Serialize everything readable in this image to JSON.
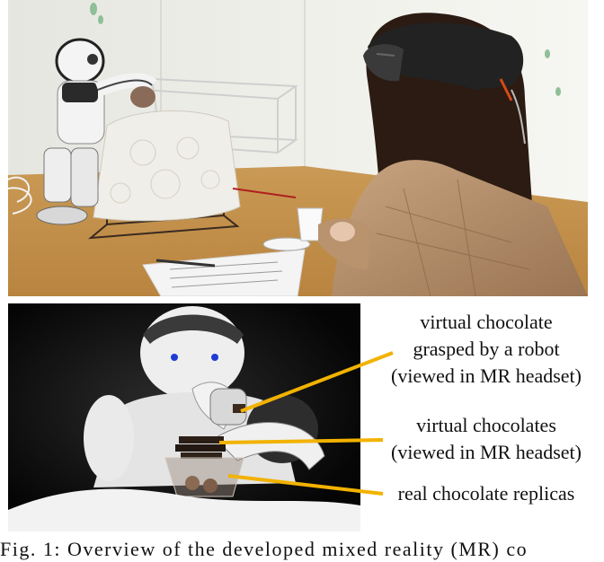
{
  "figure": {
    "annotations": [
      {
        "line1": "virtual chocolate",
        "line2": "grasped by a robot",
        "line3": "(viewed in MR headset)"
      },
      {
        "line1": "virtual chocolates",
        "line2": "(viewed in MR headset)"
      },
      {
        "line1": "real chocolate replicas"
      }
    ],
    "caption": "Fig. 1: Overview of the developed mixed reality (MR) co",
    "colors": {
      "callout": "#f2b200"
    }
  }
}
